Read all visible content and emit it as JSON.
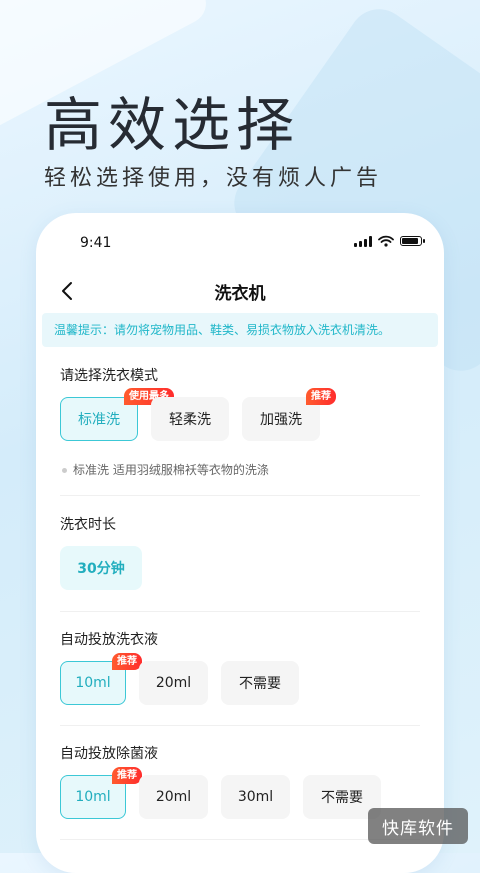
{
  "promo": {
    "headline": "高效选择",
    "subline": "轻松选择使用，没有烦人广告"
  },
  "status_bar": {
    "time": "9:41",
    "icons": [
      "signal-icon",
      "wifi-icon",
      "battery-icon"
    ]
  },
  "navbar": {
    "back_icon": "chevron-left-icon",
    "title": "洗衣机"
  },
  "tip": "温馨提示：请勿将宠物用品、鞋类、易损衣物放入洗衣机清洗。",
  "mode": {
    "title": "请选择洗衣模式",
    "options": [
      {
        "label": "标准洗",
        "selected": true,
        "badge": "使用最多"
      },
      {
        "label": "轻柔洗",
        "selected": false,
        "badge": ""
      },
      {
        "label": "加强洗",
        "selected": false,
        "badge": "推荐"
      }
    ],
    "hint": "标准洗 适用羽绒服棉袄等衣物的洗涤"
  },
  "duration": {
    "title": "洗衣时长",
    "value": "30分钟"
  },
  "detergent": {
    "title": "自动投放洗衣液",
    "options": [
      {
        "label": "10ml",
        "selected": true,
        "badge": "推荐"
      },
      {
        "label": "20ml",
        "selected": false,
        "badge": ""
      },
      {
        "label": "不需要",
        "selected": false,
        "badge": ""
      }
    ]
  },
  "disinfectant": {
    "title": "自动投放除菌液",
    "options": [
      {
        "label": "10ml",
        "selected": true,
        "badge": "推荐"
      },
      {
        "label": "20ml",
        "selected": false,
        "badge": ""
      },
      {
        "label": "30ml",
        "selected": false,
        "badge": ""
      },
      {
        "label": "不需要",
        "selected": false,
        "badge": ""
      }
    ]
  },
  "watermark": "快库软件",
  "colors": {
    "accent": "#22aebe",
    "accent_border": "#3cc8d6",
    "badge": "#ff3d2d",
    "tip_text": "#21b7c9"
  }
}
